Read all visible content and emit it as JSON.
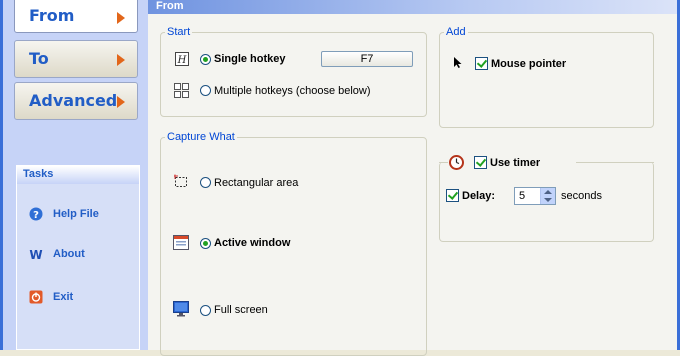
{
  "nav": {
    "from": "From",
    "to": "To",
    "advanced": "Advanced"
  },
  "tasks": {
    "title": "Tasks",
    "help": "Help File",
    "about": "About",
    "exit": "Exit"
  },
  "banner": "From",
  "start": {
    "legend": "Start",
    "single_hotkey": "Single hotkey",
    "hotkey_value": "F7",
    "multiple_hotkeys": "Multiple hotkeys  (choose below)"
  },
  "add": {
    "legend": "Add",
    "mouse_pointer": "Mouse pointer"
  },
  "capture": {
    "legend": "Capture What",
    "rect": "Rectangular area",
    "active": "Active window",
    "full": "Full screen"
  },
  "timer": {
    "use_timer": "Use timer",
    "delay_label": "Delay:",
    "delay_value": "5",
    "unit": "seconds"
  },
  "colors": {
    "accent": "#215dc6",
    "arrow": "#e2661a",
    "check": "#21a121"
  }
}
